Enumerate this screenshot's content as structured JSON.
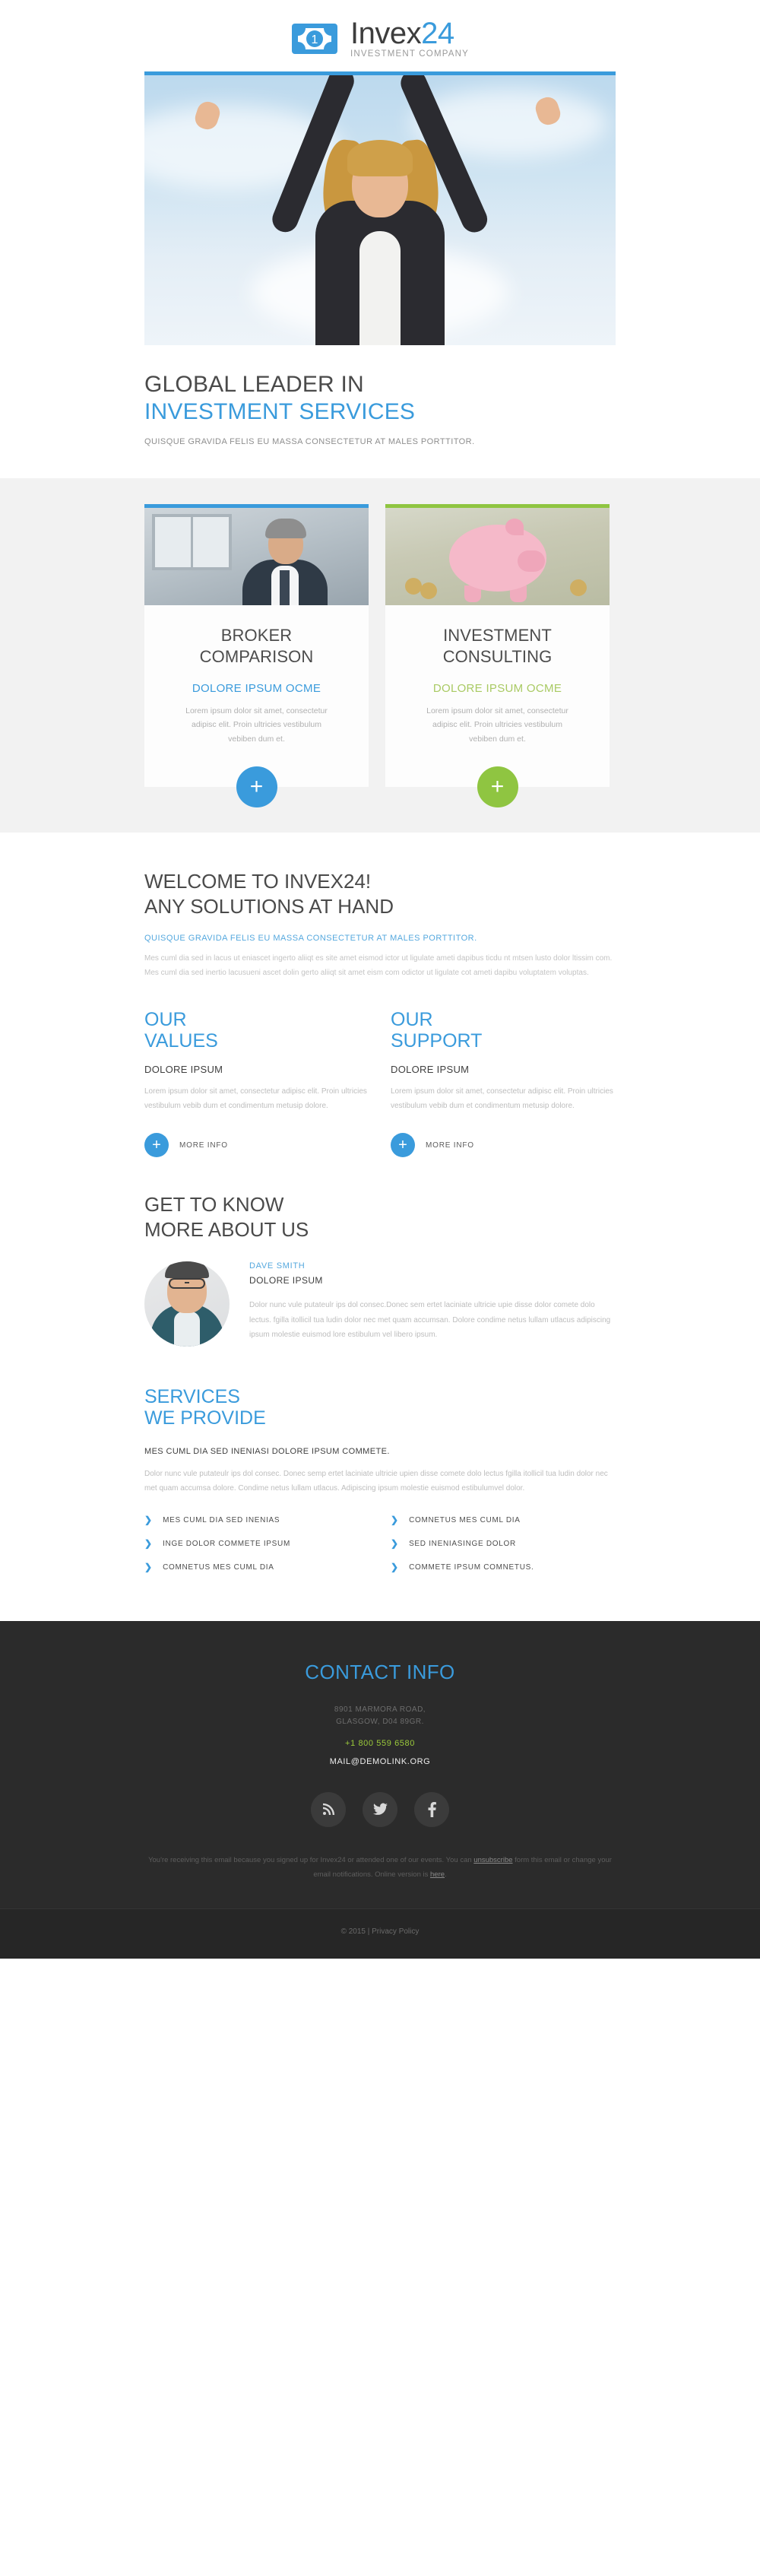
{
  "logo": {
    "icon": "banknote-icon",
    "name_dark": "Invex",
    "name_accent": "24",
    "tagline": "INVESTMENT COMPANY"
  },
  "hero": {
    "headline_line1": "GLOBAL LEADER IN",
    "headline_line2": "INVESTMENT SERVICES",
    "subtitle": "QUISQUE GRAVIDA FELIS EU MASSA CONSECTETUR AT MALES PORTTITOR.",
    "image_alt": "businesswoman-with-raised-arms"
  },
  "cards": [
    {
      "accent": "#3a9bdc",
      "image_alt": "businessman-in-office",
      "title_line1": "BROKER",
      "title_line2": "COMPARISON",
      "kicker": "DOLORE IPSUM OCME",
      "text": "Lorem ipsum dolor sit amet, consectetur adipisc elit. Proin ultricies vestibulum vebiben dum et.",
      "plus_label": "+"
    },
    {
      "accent": "#8fc541",
      "image_alt": "piggy-bank-with-coins",
      "title_line1": "INVESTMENT",
      "title_line2": "CONSULTING",
      "kicker": "DOLORE IPSUM OCME",
      "text": "Lorem ipsum dolor sit amet, consectetur adipisc elit. Proin ultricies vestibulum vebiben dum et.",
      "plus_label": "+"
    }
  ],
  "welcome": {
    "heading_line1": "WELCOME TO INVEX24!",
    "heading_line2": "ANY SOLUTIONS AT HAND",
    "kicker": "QUISQUE GRAVIDA FELIS EU MASSA CONSECTETUR AT MALES PORTTITOR.",
    "body": "Mes cuml dia sed in lacus ut eniascet ingerto aliiqt es site amet eismod ictor ut ligulate ameti dapibus ticdu nt mtsen lusto dolor ltissim com. Mes cuml dia sed inertio lacusueni ascet dolin gerto aliiqt sit amet eism com odictor ut ligulate cot ameti dapibu voluptatem voluptas."
  },
  "columns": [
    {
      "heading_line1": "OUR",
      "heading_line2": "VALUES",
      "subheading": "DOLORE IPSUM",
      "text": "Lorem ipsum dolor sit amet, consectetur adipisc elit. Proin ultricies vestibulum vebib dum et condimentum metusip dolore.",
      "cta_label": "MORE INFO",
      "cta_icon": "+"
    },
    {
      "heading_line1": "OUR",
      "heading_line2": "SUPPORT",
      "subheading": "DOLORE IPSUM",
      "text": "Lorem ipsum dolor sit amet, consectetur adipisc elit. Proin ultricies vestibulum vebib dum et condimentum metusip dolore.",
      "cta_label": "MORE INFO",
      "cta_icon": "+"
    }
  ],
  "about": {
    "heading_line1": "GET TO KNOW",
    "heading_line2": "MORE ABOUT US",
    "avatar_alt": "portrait-of-man-with-glasses",
    "person_name": "DAVE SMITH",
    "person_role": "DOLORE IPSUM",
    "body": "Dolor nunc vule putateulr ips dol consec.Donec sem ertet laciniate ultricie upie disse dolor comete dolo lectus. fgilla itollicil tua ludin dolor nec met quam accumsan. Dolore condime netus lullam utlacus adipiscing ipsum molestie euismod lore estibulum vel libero ipsum."
  },
  "services": {
    "heading_line1": "SERVICES",
    "heading_line2": "WE PROVIDE",
    "kicker": "MES CUML DIA SED INENIASI DOLORE IPSUM COMMETE.",
    "text": "Dolor nunc vule putateulr ips dol consec. Donec semp ertet laciniate ultricie upien disse comete dolo lectus fgilla itollicil tua ludin dolor nec met quam accumsa dolore. Condime netus lullam utlacus. Adipiscing ipsum molestie euismod estibulumvel dolor.",
    "list_left": [
      "MES CUML DIA SED INENIAS",
      "INGE DOLOR COMMETE IPSUM",
      "COMNETUS MES CUML DIA"
    ],
    "list_right": [
      "COMNETUS MES CUML DIA",
      "SED INENIASINGE DOLOR",
      "COMMETE IPSUM COMNETUS."
    ]
  },
  "footer": {
    "heading": "CONTACT INFO",
    "address_line1": "8901 MARMORA ROAD,",
    "address_line2": "GLASGOW, D04 89GR.",
    "phone": "+1 800 559 6580",
    "email": "MAIL@DEMOLINK.ORG",
    "social": [
      {
        "name": "rss-icon"
      },
      {
        "name": "twitter-icon"
      },
      {
        "name": "facebook-icon"
      }
    ],
    "legal_part1": "You're receiving this email because you signed up for ",
    "legal_brand": "Invex24",
    "legal_part2": " or attended one of our events. You can ",
    "legal_unsubscribe": "unsubscribe",
    "legal_part3": " form this email or change your email notifications. Online version is ",
    "legal_here": "here",
    "legal_part4": ".",
    "copyright": "© 2015  |  Privacy Policy"
  },
  "colors": {
    "accent_blue": "#3a9bdc",
    "accent_green": "#8fc541",
    "phone_green": "#9ccb3b",
    "dark_footer": "#2b2b2b",
    "band_gray": "#f2f2f2"
  }
}
